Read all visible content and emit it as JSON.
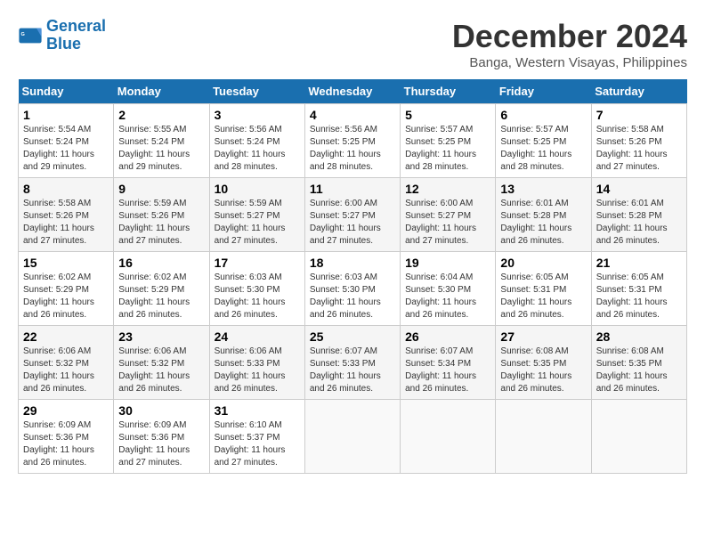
{
  "logo": {
    "line1": "General",
    "line2": "Blue"
  },
  "title": "December 2024",
  "location": "Banga, Western Visayas, Philippines",
  "days_of_week": [
    "Sunday",
    "Monday",
    "Tuesday",
    "Wednesday",
    "Thursday",
    "Friday",
    "Saturday"
  ],
  "weeks": [
    [
      {
        "num": "1",
        "sunrise": "5:54 AM",
        "sunset": "5:24 PM",
        "daylight": "11 hours and 29 minutes."
      },
      {
        "num": "2",
        "sunrise": "5:55 AM",
        "sunset": "5:24 PM",
        "daylight": "11 hours and 29 minutes."
      },
      {
        "num": "3",
        "sunrise": "5:56 AM",
        "sunset": "5:24 PM",
        "daylight": "11 hours and 28 minutes."
      },
      {
        "num": "4",
        "sunrise": "5:56 AM",
        "sunset": "5:25 PM",
        "daylight": "11 hours and 28 minutes."
      },
      {
        "num": "5",
        "sunrise": "5:57 AM",
        "sunset": "5:25 PM",
        "daylight": "11 hours and 28 minutes."
      },
      {
        "num": "6",
        "sunrise": "5:57 AM",
        "sunset": "5:25 PM",
        "daylight": "11 hours and 28 minutes."
      },
      {
        "num": "7",
        "sunrise": "5:58 AM",
        "sunset": "5:26 PM",
        "daylight": "11 hours and 27 minutes."
      }
    ],
    [
      {
        "num": "8",
        "sunrise": "5:58 AM",
        "sunset": "5:26 PM",
        "daylight": "11 hours and 27 minutes."
      },
      {
        "num": "9",
        "sunrise": "5:59 AM",
        "sunset": "5:26 PM",
        "daylight": "11 hours and 27 minutes."
      },
      {
        "num": "10",
        "sunrise": "5:59 AM",
        "sunset": "5:27 PM",
        "daylight": "11 hours and 27 minutes."
      },
      {
        "num": "11",
        "sunrise": "6:00 AM",
        "sunset": "5:27 PM",
        "daylight": "11 hours and 27 minutes."
      },
      {
        "num": "12",
        "sunrise": "6:00 AM",
        "sunset": "5:27 PM",
        "daylight": "11 hours and 27 minutes."
      },
      {
        "num": "13",
        "sunrise": "6:01 AM",
        "sunset": "5:28 PM",
        "daylight": "11 hours and 26 minutes."
      },
      {
        "num": "14",
        "sunrise": "6:01 AM",
        "sunset": "5:28 PM",
        "daylight": "11 hours and 26 minutes."
      }
    ],
    [
      {
        "num": "15",
        "sunrise": "6:02 AM",
        "sunset": "5:29 PM",
        "daylight": "11 hours and 26 minutes."
      },
      {
        "num": "16",
        "sunrise": "6:02 AM",
        "sunset": "5:29 PM",
        "daylight": "11 hours and 26 minutes."
      },
      {
        "num": "17",
        "sunrise": "6:03 AM",
        "sunset": "5:30 PM",
        "daylight": "11 hours and 26 minutes."
      },
      {
        "num": "18",
        "sunrise": "6:03 AM",
        "sunset": "5:30 PM",
        "daylight": "11 hours and 26 minutes."
      },
      {
        "num": "19",
        "sunrise": "6:04 AM",
        "sunset": "5:30 PM",
        "daylight": "11 hours and 26 minutes."
      },
      {
        "num": "20",
        "sunrise": "6:05 AM",
        "sunset": "5:31 PM",
        "daylight": "11 hours and 26 minutes."
      },
      {
        "num": "21",
        "sunrise": "6:05 AM",
        "sunset": "5:31 PM",
        "daylight": "11 hours and 26 minutes."
      }
    ],
    [
      {
        "num": "22",
        "sunrise": "6:06 AM",
        "sunset": "5:32 PM",
        "daylight": "11 hours and 26 minutes."
      },
      {
        "num": "23",
        "sunrise": "6:06 AM",
        "sunset": "5:32 PM",
        "daylight": "11 hours and 26 minutes."
      },
      {
        "num": "24",
        "sunrise": "6:06 AM",
        "sunset": "5:33 PM",
        "daylight": "11 hours and 26 minutes."
      },
      {
        "num": "25",
        "sunrise": "6:07 AM",
        "sunset": "5:33 PM",
        "daylight": "11 hours and 26 minutes."
      },
      {
        "num": "26",
        "sunrise": "6:07 AM",
        "sunset": "5:34 PM",
        "daylight": "11 hours and 26 minutes."
      },
      {
        "num": "27",
        "sunrise": "6:08 AM",
        "sunset": "5:35 PM",
        "daylight": "11 hours and 26 minutes."
      },
      {
        "num": "28",
        "sunrise": "6:08 AM",
        "sunset": "5:35 PM",
        "daylight": "11 hours and 26 minutes."
      }
    ],
    [
      {
        "num": "29",
        "sunrise": "6:09 AM",
        "sunset": "5:36 PM",
        "daylight": "11 hours and 26 minutes."
      },
      {
        "num": "30",
        "sunrise": "6:09 AM",
        "sunset": "5:36 PM",
        "daylight": "11 hours and 27 minutes."
      },
      {
        "num": "31",
        "sunrise": "6:10 AM",
        "sunset": "5:37 PM",
        "daylight": "11 hours and 27 minutes."
      },
      null,
      null,
      null,
      null
    ]
  ]
}
